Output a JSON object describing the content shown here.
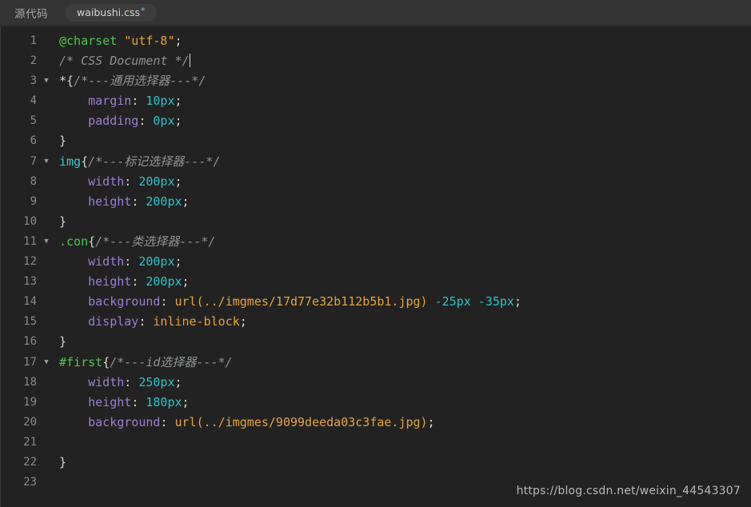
{
  "window": {
    "title": "waibushi.css",
    "background_color": "#222222",
    "header_color": "#333333"
  },
  "tabbar": {
    "source_label": "源代码",
    "tab": {
      "filename": "waibushi.css",
      "dirty_marker": "*"
    }
  },
  "editor": {
    "fold_marker": "▼",
    "caret": "|",
    "lines": [
      {
        "number": "1",
        "fold": "",
        "tokens": [
          {
            "text": "@charset",
            "type": "atrule"
          },
          {
            "text": " ",
            "type": "plain"
          },
          {
            "text": "\"utf-8\"",
            "type": "string"
          },
          {
            "text": ";",
            "type": "punc"
          }
        ]
      },
      {
        "number": "2",
        "fold": "",
        "tokens": [
          {
            "text": "/* CSS Document */",
            "type": "comment"
          },
          {
            "text": "",
            "type": "caret"
          }
        ]
      },
      {
        "number": "3",
        "fold": "▼",
        "tokens": [
          {
            "text": "*",
            "type": "plain"
          },
          {
            "text": "{",
            "type": "punc"
          },
          {
            "text": "/*---通用选择器---*/",
            "type": "comment"
          }
        ]
      },
      {
        "number": "4",
        "fold": "",
        "tokens": [
          {
            "text": "    ",
            "type": "plain"
          },
          {
            "text": "margin",
            "type": "prop"
          },
          {
            "text": ": ",
            "type": "punc"
          },
          {
            "text": "10px",
            "type": "num"
          },
          {
            "text": ";",
            "type": "punc"
          }
        ]
      },
      {
        "number": "5",
        "fold": "",
        "tokens": [
          {
            "text": "    ",
            "type": "plain"
          },
          {
            "text": "padding",
            "type": "prop"
          },
          {
            "text": ": ",
            "type": "punc"
          },
          {
            "text": "0px",
            "type": "num"
          },
          {
            "text": ";",
            "type": "punc"
          }
        ]
      },
      {
        "number": "6",
        "fold": "",
        "tokens": [
          {
            "text": "}",
            "type": "punc"
          }
        ]
      },
      {
        "number": "7",
        "fold": "▼",
        "tokens": [
          {
            "text": "img",
            "type": "sel-tag"
          },
          {
            "text": "{",
            "type": "punc"
          },
          {
            "text": "/*---标记选择器---*/",
            "type": "comment"
          }
        ]
      },
      {
        "number": "8",
        "fold": "",
        "tokens": [
          {
            "text": "    ",
            "type": "plain"
          },
          {
            "text": "width",
            "type": "prop"
          },
          {
            "text": ": ",
            "type": "punc"
          },
          {
            "text": "200px",
            "type": "num"
          },
          {
            "text": ";",
            "type": "punc"
          }
        ]
      },
      {
        "number": "9",
        "fold": "",
        "tokens": [
          {
            "text": "    ",
            "type": "plain"
          },
          {
            "text": "height",
            "type": "prop"
          },
          {
            "text": ": ",
            "type": "punc"
          },
          {
            "text": "200px",
            "type": "num"
          },
          {
            "text": ";",
            "type": "punc"
          }
        ]
      },
      {
        "number": "10",
        "fold": "",
        "tokens": [
          {
            "text": "}",
            "type": "punc"
          }
        ]
      },
      {
        "number": "11",
        "fold": "▼",
        "tokens": [
          {
            "text": ".con",
            "type": "sel-name"
          },
          {
            "text": "{",
            "type": "punc"
          },
          {
            "text": "/*---类选择器---*/",
            "type": "comment"
          }
        ]
      },
      {
        "number": "12",
        "fold": "",
        "tokens": [
          {
            "text": "    ",
            "type": "plain"
          },
          {
            "text": "width",
            "type": "prop"
          },
          {
            "text": ": ",
            "type": "punc"
          },
          {
            "text": "200px",
            "type": "num"
          },
          {
            "text": ";",
            "type": "punc"
          }
        ]
      },
      {
        "number": "13",
        "fold": "",
        "tokens": [
          {
            "text": "    ",
            "type": "plain"
          },
          {
            "text": "height",
            "type": "prop"
          },
          {
            "text": ": ",
            "type": "punc"
          },
          {
            "text": "200px",
            "type": "num"
          },
          {
            "text": ";",
            "type": "punc"
          }
        ]
      },
      {
        "number": "14",
        "fold": "",
        "tokens": [
          {
            "text": "    ",
            "type": "plain"
          },
          {
            "text": "background",
            "type": "prop"
          },
          {
            "text": ": ",
            "type": "punc"
          },
          {
            "text": "url(../imgmes/17d77e32b112b5b1.jpg)",
            "type": "val"
          },
          {
            "text": " ",
            "type": "plain"
          },
          {
            "text": "-25px",
            "type": "num"
          },
          {
            "text": " ",
            "type": "plain"
          },
          {
            "text": "-35px",
            "type": "num"
          },
          {
            "text": ";",
            "type": "punc"
          }
        ]
      },
      {
        "number": "15",
        "fold": "",
        "tokens": [
          {
            "text": "    ",
            "type": "plain"
          },
          {
            "text": "display",
            "type": "prop"
          },
          {
            "text": ": ",
            "type": "punc"
          },
          {
            "text": "inline-block",
            "type": "val"
          },
          {
            "text": ";",
            "type": "punc"
          }
        ]
      },
      {
        "number": "16",
        "fold": "",
        "tokens": [
          {
            "text": "}",
            "type": "punc"
          }
        ]
      },
      {
        "number": "17",
        "fold": "▼",
        "tokens": [
          {
            "text": "#first",
            "type": "sel-name"
          },
          {
            "text": "{",
            "type": "punc"
          },
          {
            "text": "/*---id选择器---*/",
            "type": "comment"
          }
        ]
      },
      {
        "number": "18",
        "fold": "",
        "tokens": [
          {
            "text": "    ",
            "type": "plain"
          },
          {
            "text": "width",
            "type": "prop"
          },
          {
            "text": ": ",
            "type": "punc"
          },
          {
            "text": "250px",
            "type": "num"
          },
          {
            "text": ";",
            "type": "punc"
          }
        ]
      },
      {
        "number": "19",
        "fold": "",
        "tokens": [
          {
            "text": "    ",
            "type": "plain"
          },
          {
            "text": "height",
            "type": "prop"
          },
          {
            "text": ": ",
            "type": "punc"
          },
          {
            "text": "180px",
            "type": "num"
          },
          {
            "text": ";",
            "type": "punc"
          }
        ]
      },
      {
        "number": "20",
        "fold": "",
        "tokens": [
          {
            "text": "    ",
            "type": "plain"
          },
          {
            "text": "background",
            "type": "prop"
          },
          {
            "text": ": ",
            "type": "punc"
          },
          {
            "text": "url(../imgmes/9099deeda03c3fae.jpg)",
            "type": "val"
          },
          {
            "text": ";",
            "type": "punc"
          }
        ]
      },
      {
        "number": "21",
        "fold": "",
        "tokens": []
      },
      {
        "number": "22",
        "fold": "",
        "tokens": [
          {
            "text": "}",
            "type": "punc"
          }
        ]
      },
      {
        "number": "23",
        "fold": "",
        "tokens": []
      }
    ]
  },
  "watermark": {
    "text": "https://blog.csdn.net/weixin_44543307"
  }
}
